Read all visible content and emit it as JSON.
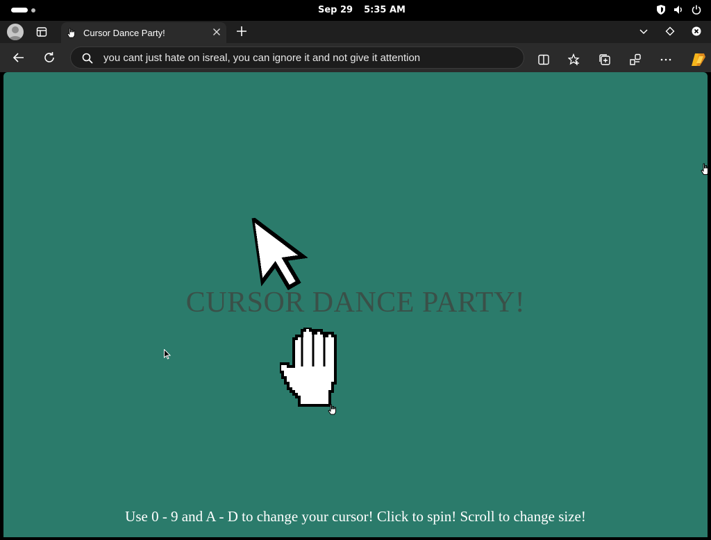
{
  "system_bar": {
    "date": "Sep 29",
    "time": "5:35 AM",
    "tray_icons": [
      "shield-icon",
      "volume-icon",
      "power-icon"
    ]
  },
  "browser": {
    "tab": {
      "title": "Cursor Dance Party!",
      "favicon": "hand-cursor-icon"
    },
    "address_bar": {
      "value": "you cant just hate on isreal, you can ignore it and not give it attention"
    },
    "toolbar_icons": [
      "split-screen-icon",
      "favorites-icon",
      "collections-icon",
      "extensions-icon",
      "more-icon",
      "copilot-icon"
    ]
  },
  "page": {
    "background": "#2b7b6b",
    "headline": "CURSOR DANCE PARTY!",
    "instructions": "Use 0 - 9 and A - D to change your cursor! Click to spin! Scroll to change size!"
  }
}
